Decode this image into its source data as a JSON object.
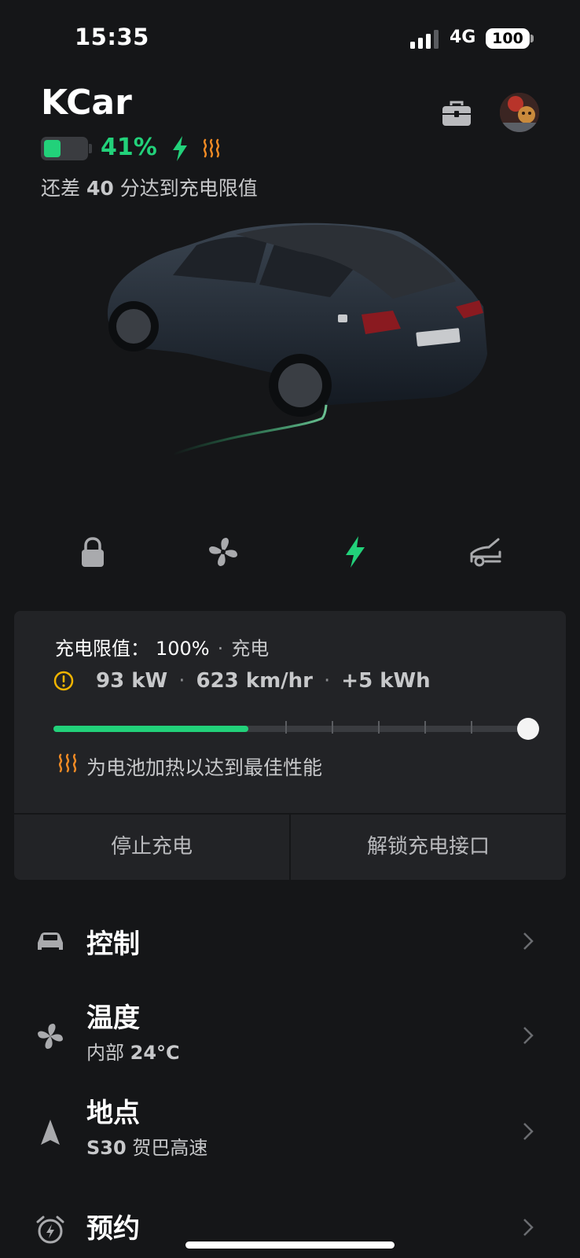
{
  "status_bar": {
    "time": "15:35",
    "network": "4G",
    "battery": "100"
  },
  "header": {
    "car_name": "KCar",
    "soc": "41%",
    "eta_prefix": "还差 ",
    "eta_value": "40",
    "eta_suffix": " 分达到充电限值",
    "battery_level": 0.41
  },
  "quick_actions": [
    {
      "icon": "lock-icon"
    },
    {
      "icon": "fan-icon"
    },
    {
      "icon": "charge-bolt-icon"
    },
    {
      "icon": "trunk-icon"
    }
  ],
  "charge_card": {
    "limit_label": "充电限值：",
    "limit_value": "100%",
    "dot": "·",
    "state": "充电",
    "power": "93 kW",
    "rate": "623 km/hr",
    "added": "+5 kWh",
    "sep": "·",
    "progress": 0.41,
    "heat_message": "为电池加热以达到最佳性能",
    "stop_button": "停止充电",
    "unlock_button": "解锁充电接口"
  },
  "menu": [
    {
      "title": "控制",
      "icon": "car-icon"
    },
    {
      "title": "温度",
      "sub_prefix": "内部 ",
      "sub_value": "24°C",
      "icon": "fan-icon"
    },
    {
      "title": "地点",
      "sub_value": "S30",
      "sub_suffix": " 贺巴高速",
      "icon": "location-arrow-icon"
    },
    {
      "title": "预约",
      "icon": "alarm-clock-icon"
    }
  ],
  "colors": {
    "accent": "#22d17a",
    "heat": "#f08a24",
    "background": "#151618",
    "card": "#222326"
  }
}
